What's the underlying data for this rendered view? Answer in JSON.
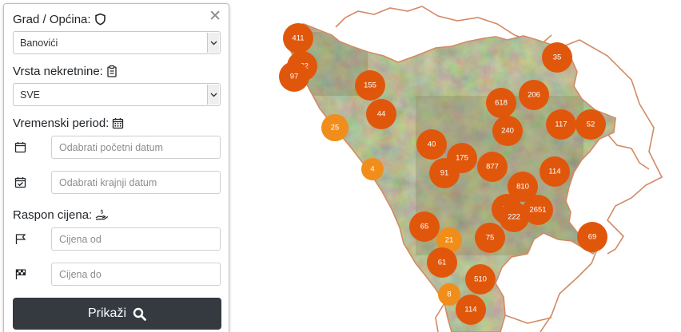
{
  "panel": {
    "city_label": "Grad / Općina:",
    "city_selected": "Banovići",
    "type_label": "Vrsta nekretnine:",
    "type_selected": "SVE",
    "period_label": "Vremenski period:",
    "start_date_placeholder": "Odabrati početni datum",
    "end_date_placeholder": "Odabrati krajnji datum",
    "price_label": "Raspon cijena:",
    "price_from_placeholder": "Cijena od",
    "price_to_placeholder": "Cijena do",
    "show_button_label": "Prikaži"
  },
  "icons": {
    "city": "shield-icon",
    "type": "clipboard-icon",
    "period": "calendar-grid-icon",
    "start": "calendar-icon",
    "end": "calendar-check-icon",
    "price": "cash-hand-icon",
    "from": "flag-icon",
    "to": "checkered-flag-icon",
    "button": "search-icon"
  },
  "map": {
    "clusters": [
      "411",
      "382",
      "97",
      "155",
      "44",
      "25",
      "4",
      "618",
      "206",
      "35",
      "240",
      "117",
      "52",
      "40",
      "175",
      "877",
      "91",
      "114",
      "810",
      "73",
      "2651",
      "222",
      "65",
      "21",
      "75",
      "69",
      "61",
      "510",
      "8",
      "114"
    ]
  },
  "colors": {
    "cluster_dark": "#e0570c",
    "cluster_light": "#f18d1a",
    "border": "#d38a64",
    "button_bg": "#343a40"
  }
}
